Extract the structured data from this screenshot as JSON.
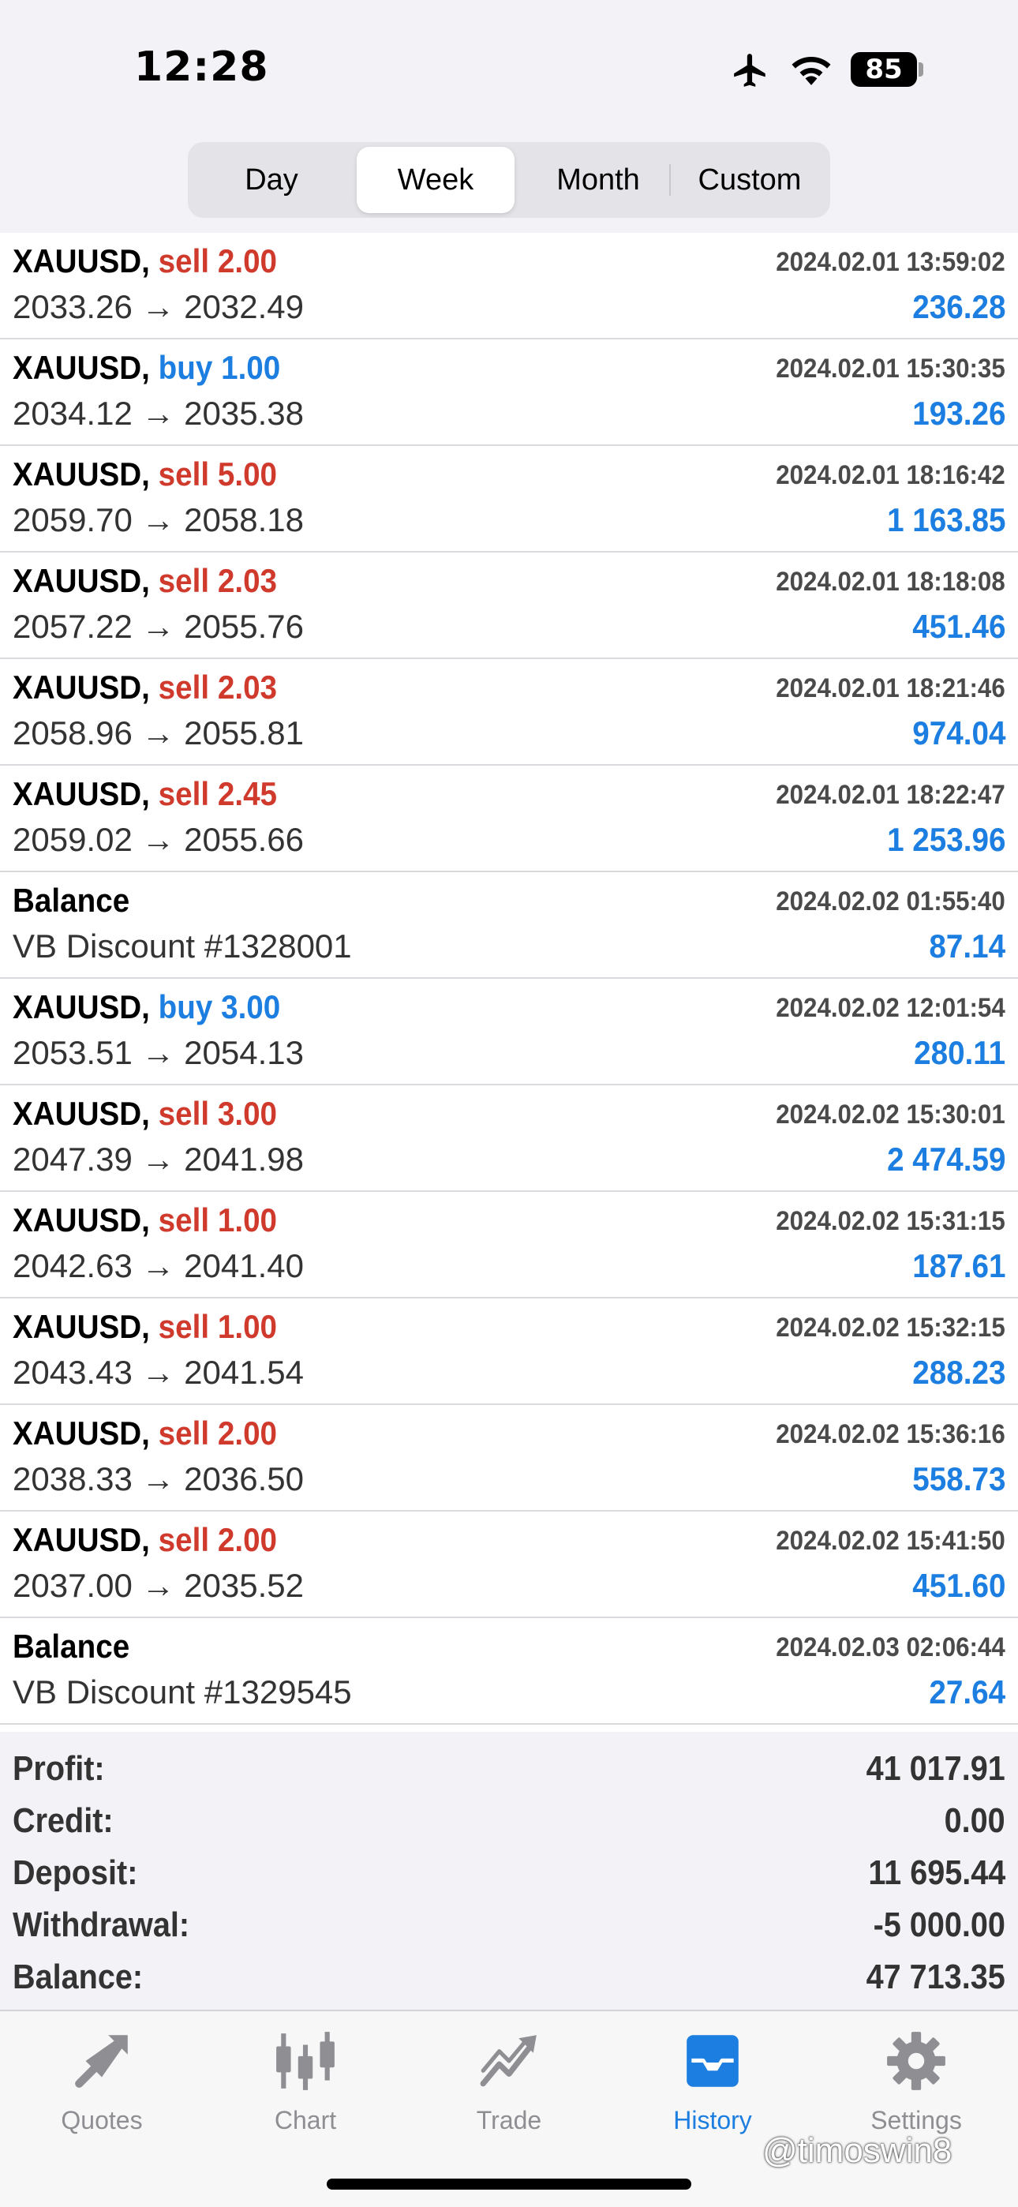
{
  "status_bar": {
    "time": "12:28",
    "battery": "85"
  },
  "period_tabs": [
    "Day",
    "Week",
    "Month",
    "Custom"
  ],
  "active_period": "Week",
  "deals": [
    {
      "title": "XAUUSD",
      "sep": ", ",
      "side": "sell",
      "volume": "2.00",
      "time": "2024.02.01 13:59:02",
      "prices": "2033.26 → 2032.49",
      "profit": "236.28"
    },
    {
      "title": "XAUUSD",
      "sep": ", ",
      "side": "buy",
      "volume": "1.00",
      "time": "2024.02.01 15:30:35",
      "prices": "2034.12 → 2035.38",
      "profit": "193.26"
    },
    {
      "title": "XAUUSD",
      "sep": ", ",
      "side": "sell",
      "volume": "5.00",
      "time": "2024.02.01 18:16:42",
      "prices": "2059.70 → 2058.18",
      "profit": "1 163.85"
    },
    {
      "title": "XAUUSD",
      "sep": ", ",
      "side": "sell",
      "volume": "2.03",
      "time": "2024.02.01 18:18:08",
      "prices": "2057.22 → 2055.76",
      "profit": "451.46"
    },
    {
      "title": "XAUUSD",
      "sep": ", ",
      "side": "sell",
      "volume": "2.03",
      "time": "2024.02.01 18:21:46",
      "prices": "2058.96 → 2055.81",
      "profit": "974.04"
    },
    {
      "title": "XAUUSD",
      "sep": ", ",
      "side": "sell",
      "volume": "2.45",
      "time": "2024.02.01 18:22:47",
      "prices": "2059.02 → 2055.66",
      "profit": "1 253.96"
    },
    {
      "title": "Balance",
      "sep": "",
      "side": "",
      "volume": "",
      "time": "2024.02.02 01:55:40",
      "prices": "VB Discount #1328001",
      "profit": "87.14"
    },
    {
      "title": "XAUUSD",
      "sep": ", ",
      "side": "buy",
      "volume": "3.00",
      "time": "2024.02.02 12:01:54",
      "prices": "2053.51 → 2054.13",
      "profit": "280.11"
    },
    {
      "title": "XAUUSD",
      "sep": ", ",
      "side": "sell",
      "volume": "3.00",
      "time": "2024.02.02 15:30:01",
      "prices": "2047.39 → 2041.98",
      "profit": "2 474.59"
    },
    {
      "title": "XAUUSD",
      "sep": ", ",
      "side": "sell",
      "volume": "1.00",
      "time": "2024.02.02 15:31:15",
      "prices": "2042.63 → 2041.40",
      "profit": "187.61"
    },
    {
      "title": "XAUUSD",
      "sep": ", ",
      "side": "sell",
      "volume": "1.00",
      "time": "2024.02.02 15:32:15",
      "prices": "2043.43 → 2041.54",
      "profit": "288.23"
    },
    {
      "title": "XAUUSD",
      "sep": ", ",
      "side": "sell",
      "volume": "2.00",
      "time": "2024.02.02 15:36:16",
      "prices": "2038.33 → 2036.50",
      "profit": "558.73"
    },
    {
      "title": "XAUUSD",
      "sep": ", ",
      "side": "sell",
      "volume": "2.00",
      "time": "2024.02.02 15:41:50",
      "prices": "2037.00 → 2035.52",
      "profit": "451.60"
    },
    {
      "title": "Balance",
      "sep": "",
      "side": "",
      "volume": "",
      "time": "2024.02.03 02:06:44",
      "prices": "VB Discount #1329545",
      "profit": "27.64"
    }
  ],
  "summary": [
    {
      "label": "Profit:",
      "value": "41 017.91"
    },
    {
      "label": "Credit:",
      "value": "0.00"
    },
    {
      "label": "Deposit:",
      "value": "11 695.44"
    },
    {
      "label": "Withdrawal:",
      "value": "-5 000.00"
    },
    {
      "label": "Balance:",
      "value": "47 713.35"
    }
  ],
  "tabbar": [
    {
      "label": "Quotes",
      "icon": "quotes-icon"
    },
    {
      "label": "Chart",
      "icon": "chart-icon"
    },
    {
      "label": "Trade",
      "icon": "trade-icon"
    },
    {
      "label": "History",
      "icon": "history-icon"
    },
    {
      "label": "Settings",
      "icon": "settings-icon"
    }
  ],
  "active_tab": "History",
  "watermark": "@timoswin8",
  "colors": {
    "sell": "#d03a2c",
    "buy": "#1c7ee0",
    "profit": "#1c7ee0",
    "active_tab": "#1c7ee0",
    "inactive_tab": "#8e8e93"
  }
}
